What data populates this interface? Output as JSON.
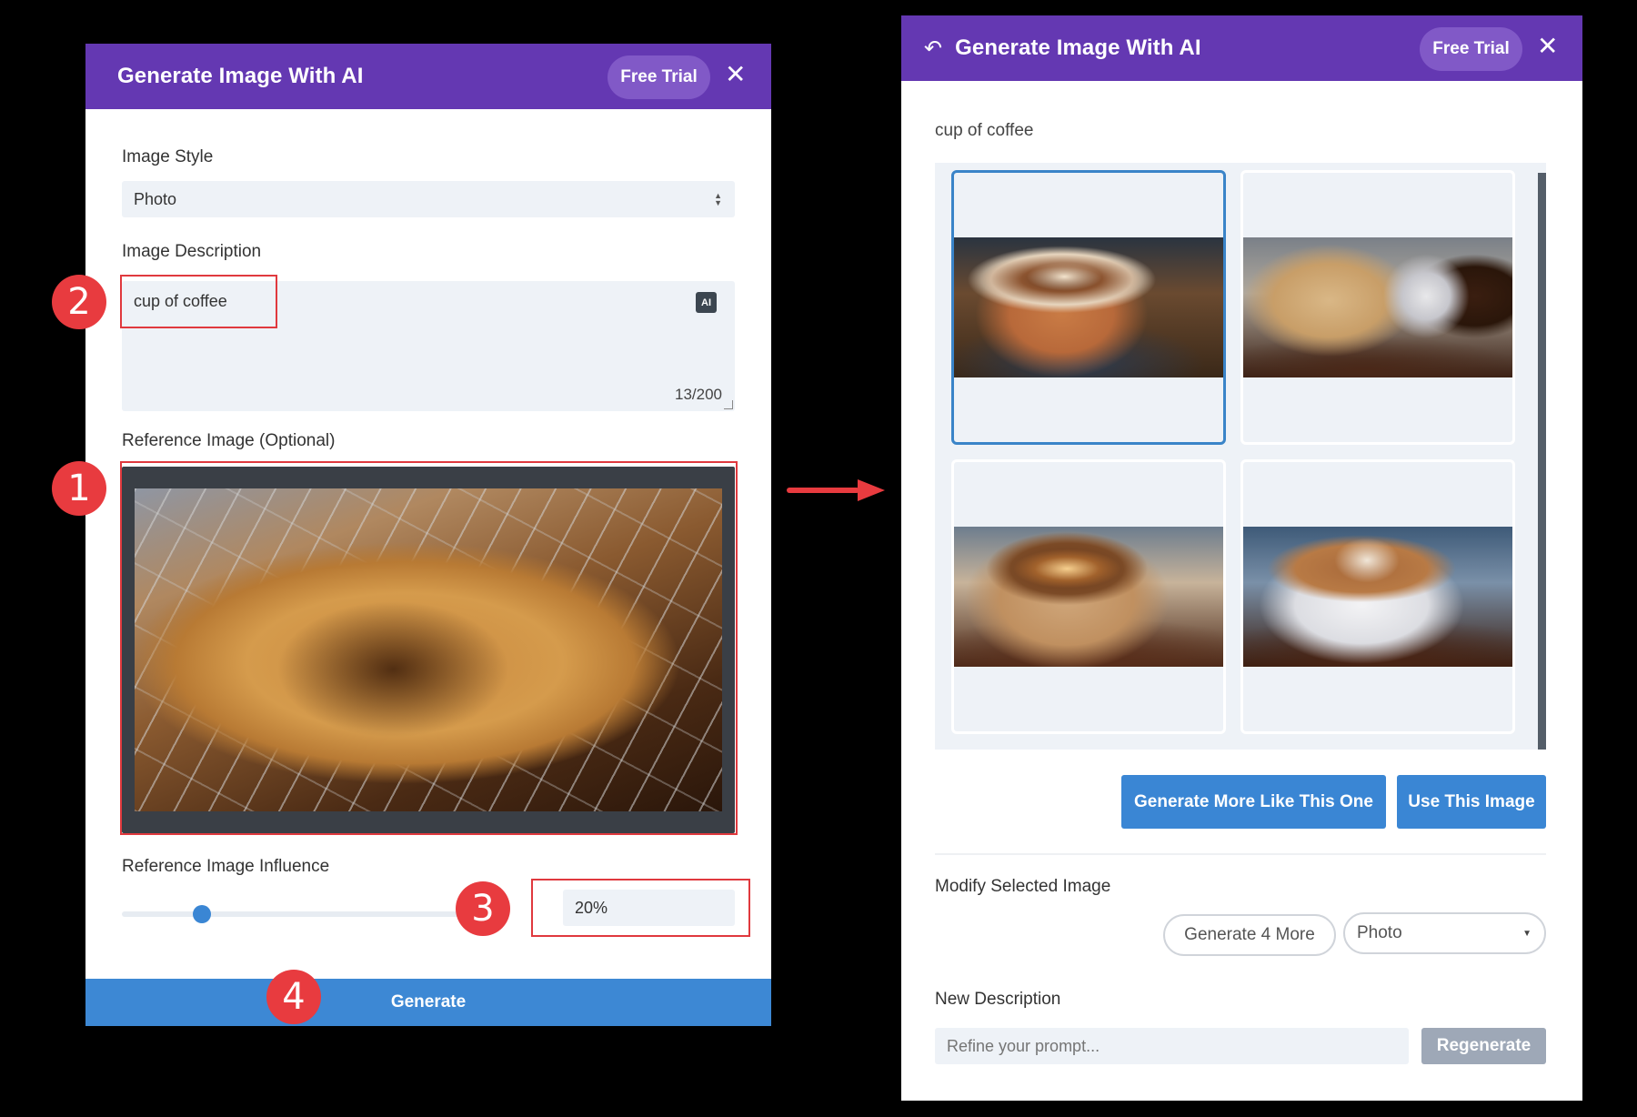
{
  "left_panel": {
    "title": "Generate Image With AI",
    "free_trial_label": "Free Trial",
    "close_glyph": "✕",
    "image_style": {
      "label": "Image Style",
      "selected": "Photo"
    },
    "image_description": {
      "label": "Image Description",
      "value": "cup of coffee",
      "ai_badge": "AI",
      "char_count": "13/200"
    },
    "reference_image": {
      "label": "Reference Image (Optional)",
      "description": "pastry on cooling rack"
    },
    "influence": {
      "label": "Reference Image Influence",
      "value_text": "20%",
      "value_fraction": 0.2
    },
    "generate_label": "Generate"
  },
  "annotations": {
    "badges": [
      "1",
      "2",
      "3",
      "4"
    ],
    "color": "#e83b3f"
  },
  "right_panel": {
    "back_icon": "↶",
    "title": "Generate Image With AI",
    "free_trial_label": "Free Trial",
    "close_glyph": "✕",
    "prompt": "cup of coffee",
    "results": [
      {
        "description": "latte with heart art in orange cup",
        "selected": true
      },
      {
        "description": "cookies beside coffee cup and beans",
        "selected": false
      },
      {
        "description": "coffee cup on coffee beans",
        "selected": false
      },
      {
        "description": "white cup latte on coffee beans",
        "selected": false
      }
    ],
    "generate_more_label": "Generate More Like This One",
    "use_image_label": "Use This Image",
    "modify": {
      "label": "Modify Selected Image",
      "generate_4_label": "Generate 4 More",
      "style_selected": "Photo"
    },
    "new_description": {
      "label": "New Description",
      "placeholder": "Refine your prompt...",
      "regenerate_label": "Regenerate"
    }
  },
  "colors": {
    "header": "#6438b2",
    "primary": "#3a86d4",
    "selected_border": "#3a84c8",
    "annotation": "#e83b3f"
  }
}
